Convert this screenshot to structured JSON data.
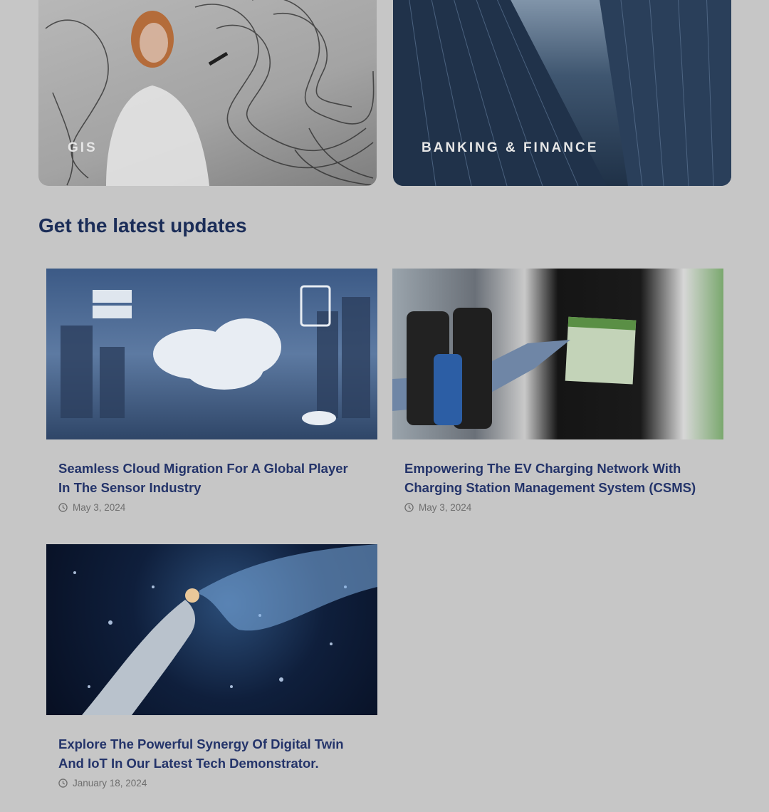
{
  "industries": [
    {
      "label": "GIS"
    },
    {
      "label": "BANKING & FINANCE"
    }
  ],
  "section": {
    "title": "Get the latest updates"
  },
  "posts": [
    {
      "title_line1": "Seamless Cloud Migration For A Global Player",
      "title_line2": "In The Sensor Industry",
      "date": "May 3, 2024"
    },
    {
      "title_line1": "Empowering The EV Charging Network With",
      "title_line2": "Charging Station Management System (CSMS)",
      "date": "May 3, 2024"
    },
    {
      "title_line1": "Explore The Powerful Synergy Of Digital Twin",
      "title_line2": "And IoT In Our Latest Tech Demonstrator.",
      "date": "January 18, 2024"
    }
  ],
  "colors": {
    "heading": "#1b2d58",
    "post_title": "#24346a",
    "background": "#c6c6c6"
  },
  "icons": {
    "date": "clock-icon"
  }
}
